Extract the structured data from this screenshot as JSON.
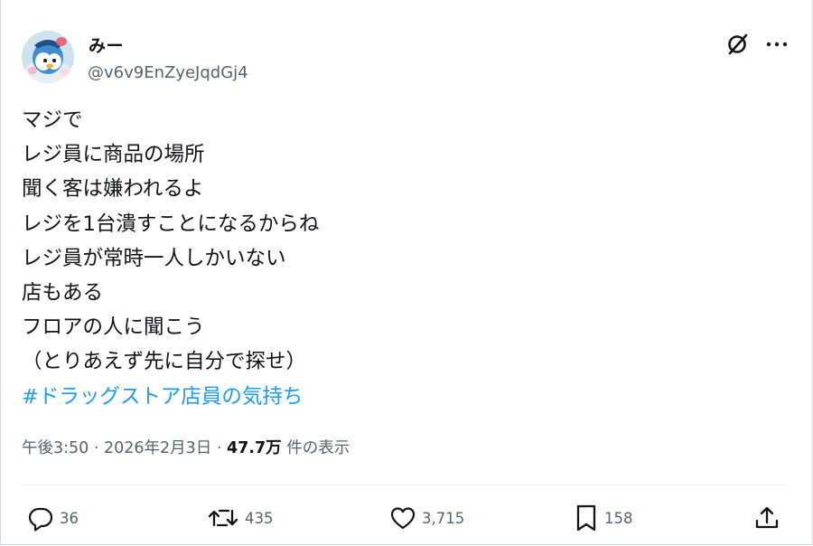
{
  "author": {
    "display_name": "みー",
    "handle": "@v6v9EnZyeJqdGj4",
    "avatar": "penguin-avatar"
  },
  "header_icons": [
    "grok-icon",
    "more-icon"
  ],
  "post": {
    "lines": [
      "マジで",
      "レジ員に商品の場所",
      "聞く客は嫌われるよ",
      "レジを1台潰すことになるからね",
      "レジ員が常時一人しかいない",
      "店もある",
      "フロアの人に聞こう",
      "（とりあえず先に自分で探せ）"
    ],
    "hashtag": "#ドラッグストア店員の気持ち"
  },
  "meta": {
    "timestamp": "午後3:50 · 2026年2月3日",
    "separator": " · ",
    "views": "47.7万",
    "views_label": " 件の表示"
  },
  "actions": {
    "replies": "36",
    "reposts": "435",
    "likes": "3,715",
    "bookmarks": "158"
  },
  "colors": {
    "text": "#0f1419",
    "secondary": "#536471",
    "link": "#1d9bf0",
    "border": "#eff3f4"
  }
}
